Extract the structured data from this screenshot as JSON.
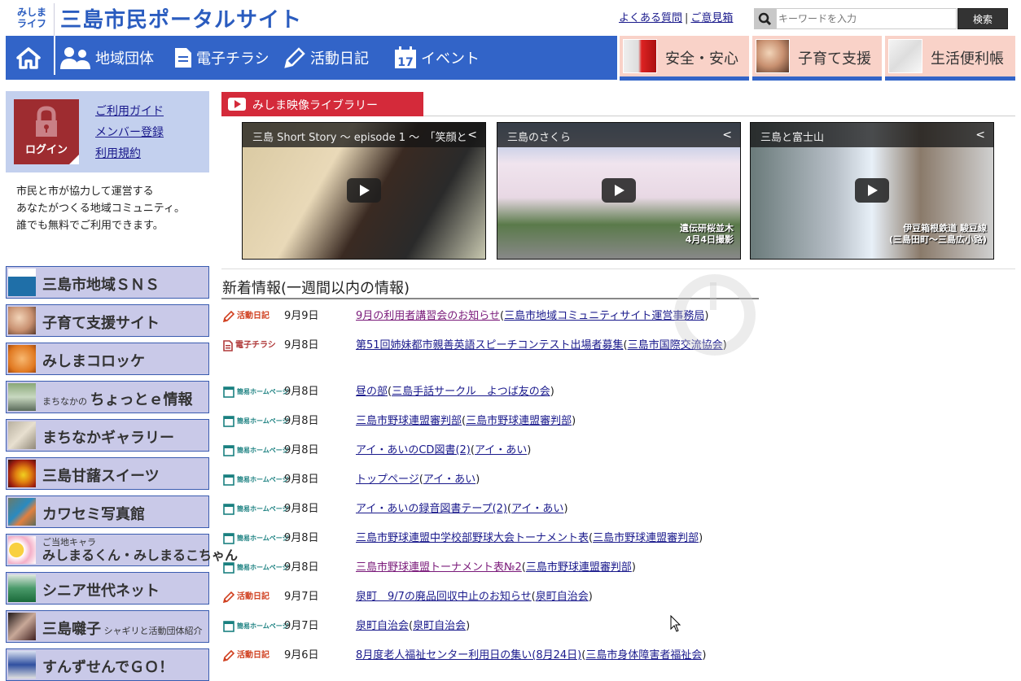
{
  "header": {
    "logo_small_line1": "みしま",
    "logo_small_line2": "ライフ",
    "site_title": "三島市民ポータルサイト",
    "links": [
      "よくある質問",
      "ご意見箱"
    ],
    "link_separator": "|",
    "search_placeholder": "キーワードを入力",
    "search_button": "検索"
  },
  "nav": {
    "items": [
      {
        "label": "地域団体",
        "icon": "people-icon"
      },
      {
        "label": "電子チラシ",
        "icon": "document-icon"
      },
      {
        "label": "活動日記",
        "icon": "pencil-icon"
      },
      {
        "label": "イベント",
        "icon": "calendar-icon",
        "icon_text": "17"
      }
    ],
    "categories": [
      "安全・安心",
      "子育て支援",
      "生活便利帳"
    ]
  },
  "sidebar": {
    "login_label": "ログイン",
    "login_links": [
      "ご利用ガイド",
      "メンバー登録",
      "利用規約"
    ],
    "intro": [
      "市民と市が協力して運営する",
      "あなたがつくる地域コミュニティ。",
      "誰でも無料でご利用できます。"
    ],
    "banners": [
      {
        "label": "三島市地域ＳＮＳ"
      },
      {
        "label": "子育て支援サイト"
      },
      {
        "label": "みしまコロッケ"
      },
      {
        "prefix": "まちなかの",
        "label": "ちょっとｅ情報"
      },
      {
        "label": "まちなかギャラリー"
      },
      {
        "label": "三島甘藷スイーツ"
      },
      {
        "label": "カワセミ写真館"
      },
      {
        "prefix": "ご当地キャラ",
        "label": "みしまるくん・みしまるこちゃん"
      },
      {
        "label": "シニア世代ネット"
      },
      {
        "label": "三島囃子",
        "suffix": "シャギリと活動団体紹介"
      },
      {
        "label": "すんずせんでＧＯ！"
      }
    ]
  },
  "video_library": {
    "title": "みしま映像ライブラリー",
    "videos": [
      {
        "title": "三島 Short Story ～ episode 1 ～　「笑顔と",
        "caption": ""
      },
      {
        "title": "三島のさくら",
        "caption_line1": "遺伝研桜並木",
        "caption_line2": "4月4日撮影"
      },
      {
        "title": "三島と富士山",
        "caption_line1": "伊豆箱根鉄道 駿豆線",
        "caption_line2": "(三島田町～三島広小路)"
      }
    ]
  },
  "news": {
    "title": "新着情報(一週間以内の情報)",
    "rows": [
      {
        "category": "活動日記",
        "type": "diary",
        "date": "9月9日",
        "title": "9月の利用者講習会のお知らせ",
        "org": "三島市地域コミュニティサイト運営事務局",
        "visited": true
      },
      {
        "category": "電子チラシ",
        "type": "flyer",
        "date": "9月8日",
        "title": "第51回姉妹都市親善英語スピーチコンテスト出場者募集",
        "org": "三島市国際交流協会",
        "visited": false
      },
      {
        "category": "簡易ホームページ",
        "type": "home",
        "date": "9月8日",
        "title": "昼の部",
        "org": "三島手話サークル　よつば友の会",
        "visited": false
      },
      {
        "category": "簡易ホームページ",
        "type": "home",
        "date": "9月8日",
        "title": "三島市野球連盟審判部",
        "org": "三島市野球連盟審判部",
        "visited": false
      },
      {
        "category": "簡易ホームページ",
        "type": "home",
        "date": "9月8日",
        "title": "アイ・あいのCD図書(2)",
        "org": "アイ・あい",
        "visited": false
      },
      {
        "category": "簡易ホームページ",
        "type": "home",
        "date": "9月8日",
        "title": "トップページ",
        "org": "アイ・あい",
        "visited": false
      },
      {
        "category": "簡易ホームページ",
        "type": "home",
        "date": "9月8日",
        "title": "アイ・あいの録音図書テープ(2)",
        "org": "アイ・あい",
        "visited": false
      },
      {
        "category": "簡易ホームページ",
        "type": "home",
        "date": "9月8日",
        "title": "三島市野球連盟中学校部野球大会トーナメント表",
        "org": "三島市野球連盟審判部",
        "visited": false
      },
      {
        "category": "簡易ホームページ",
        "type": "home",
        "date": "9月8日",
        "title": "三島市野球連盟トーナメント表№2",
        "org": "三島市野球連盟審判部",
        "visited": true
      },
      {
        "category": "活動日記",
        "type": "diary",
        "date": "9月7日",
        "title": "泉町　9/7の廃品回収中止のお知らせ",
        "org": "泉町自治会",
        "visited": false
      },
      {
        "category": "簡易ホームページ",
        "type": "home",
        "date": "9月7日",
        "title": "泉町自治会",
        "org": "泉町自治会",
        "visited": false
      },
      {
        "category": "活動日記",
        "type": "diary",
        "date": "9月6日",
        "title": "8月度老人福祉センター利用日の集い(8月24日)",
        "org": "三島市身体障害者福祉会",
        "visited": false
      }
    ]
  },
  "colors": {
    "brand_blue": "#3264c8",
    "category_pink": "#f9d2c8",
    "login_red": "#9e2c30",
    "video_red": "#d42a3a",
    "banner_lavender": "#c9c9e8"
  }
}
